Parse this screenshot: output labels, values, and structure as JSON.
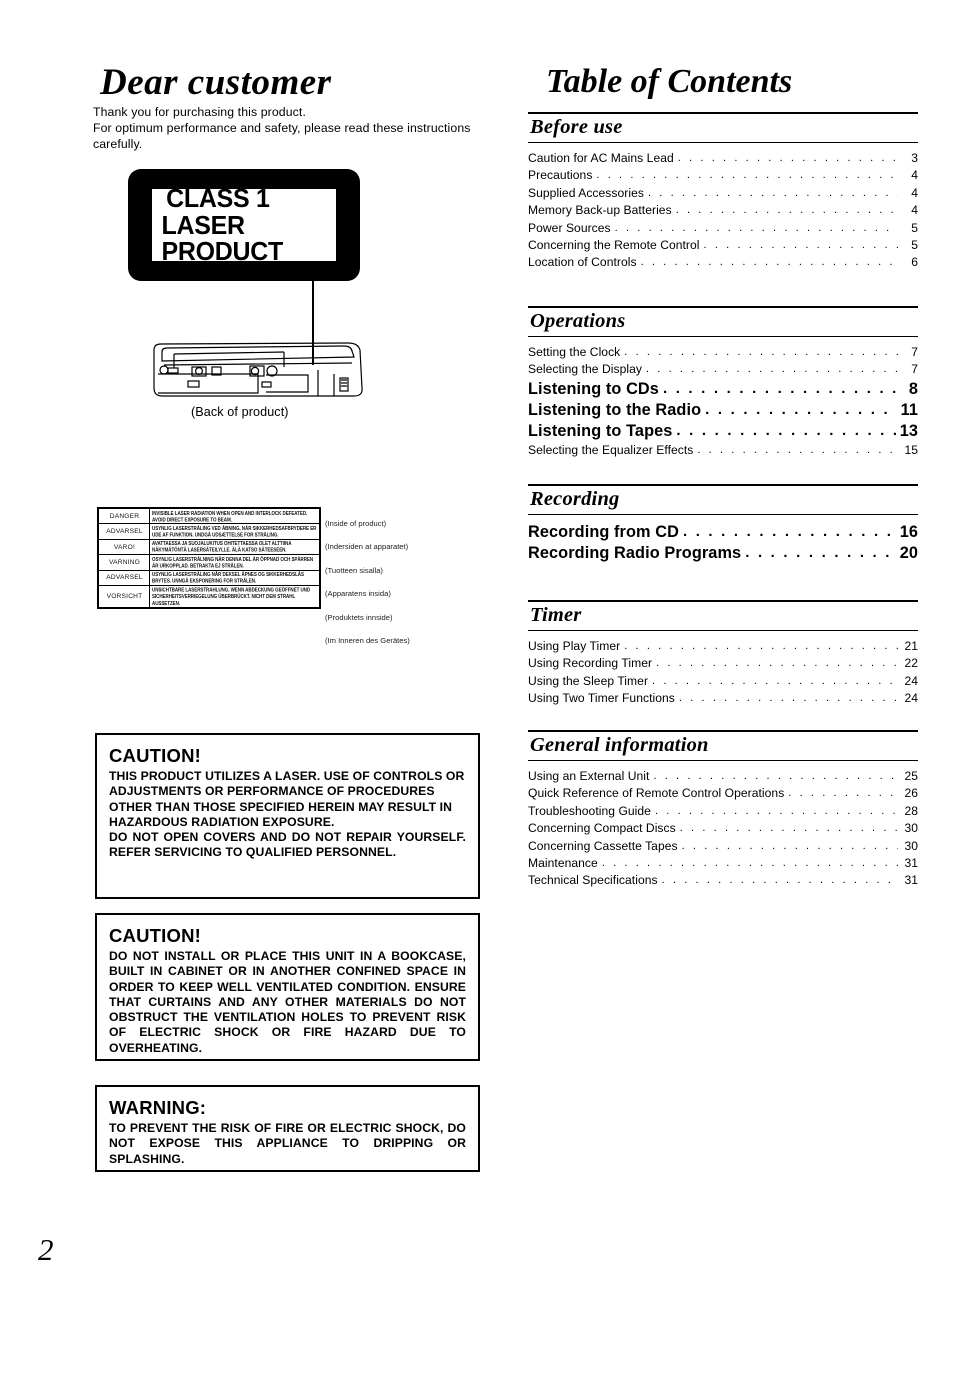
{
  "document": {
    "page_number": "2",
    "left": {
      "heading": "Dear customer",
      "intro_lines": [
        "Thank you for purchasing this product.",
        "For optimum performance and safety, please read these instructions carefully."
      ],
      "laser_label": {
        "line1": "CLASS 1",
        "line2": "LASER PRODUCT"
      },
      "product_caption": "(Back of product)",
      "warning_table": {
        "rows": [
          {
            "lang": "DANGER",
            "text": "INVISIBLE LASER RADIATION WHEN OPEN AND INTERLOCK DEFEATED. AVOID DIRECT EXPOSURE TO BEAM.",
            "note": "(Inside of product)"
          },
          {
            "lang": "ADVARSEL",
            "text": "USYNLIG LASERSTRÅLING VED ÅBNING, NÅR SIKKERHEDSAFBRYDERE ER UDE AF FUNKTION. UNDGÅ UDSÆTTELSE FOR STRÅLING.",
            "note": "(Indersiden at apparatet)"
          },
          {
            "lang": "VARO!",
            "text": "AVATTAESSA JA SUOJALUKITUS OHITETTAESSA OLET ALTTIINA NÄKYMÄTÖNTÄ LASERSÄTEILYLLE. ÄLÄ KATSO SÄTEESEEN.",
            "note": "(Tuotteen sisalla)"
          },
          {
            "lang": "VARNING",
            "text": "OSYNLIG LASERSTRÅLNING NÄR DENNA DEL ÄR ÖPPNAD OCH SPÄRREN ÄR URKOPPLAD. BETRAKTA EJ STRÅLEN.",
            "note": "(Apparatens insida)"
          },
          {
            "lang": "ADVARSEL",
            "text": "USYNLIG LASERSTRÅLING NÅR DEKSEL ÅPNES OG SIKKERHEDSLÅS BRYTES. UNNGÅ EKSPONERING FOR STRÅLEN.",
            "note": "(Produktets innside)"
          },
          {
            "lang": "VORSICHT",
            "text": "UNSICHTBARE LASERSTRAHLUNG, WENN ABDECKUNG GEÖFFNET UND SICHERHEITSVERRIEGELUNG ÜBERBRÜCKT. NICHT DEM STRAHL AUSSETZEN.",
            "note": "(Im Inneren des Gerätes)"
          }
        ]
      },
      "caution_laser": {
        "title": "CAUTION!",
        "paragraph1": "THIS PRODUCT UTILIZES A LASER. USE OF CONTROLS OR ADJUSTMENTS OR PERFORMANCE OF PROCEDURES OTHER THAN THOSE SPECIFIED HEREIN MAY RESULT IN HAZARDOUS RADIATION EXPOSURE.",
        "paragraph2": "DO NOT OPEN COVERS AND DO NOT REPAIR YOURSELF. REFER SERVICING TO QUALIFIED PERSONNEL."
      },
      "caution_install": {
        "title": "CAUTION!",
        "paragraph1": "DO NOT INSTALL OR PLACE THIS UNIT IN A BOOKCASE, BUILT IN CABINET OR IN ANOTHER CONFINED SPACE IN ORDER TO KEEP WELL VENTILATED CONDITION. ENSURE THAT CURTAINS AND ANY OTHER MATERIALS DO NOT OBSTRUCT THE VENTILATION HOLES TO PREVENT RISK OF ELECTRIC SHOCK OR FIRE HAZARD DUE TO OVERHEATING."
      },
      "warning": {
        "title": "WARNING:",
        "paragraph1": "TO PREVENT THE RISK OF FIRE OR ELECTRIC SHOCK, DO NOT EXPOSE THIS APPLIANCE TO DRIPPING OR SPLASHING."
      }
    },
    "toc": {
      "title": "Table of Contents",
      "sections": [
        {
          "heading": "Before use",
          "entries": [
            {
              "label": "Caution for AC Mains Lead",
              "page": "3",
              "emphasis": false
            },
            {
              "label": "Precautions",
              "page": "4",
              "emphasis": false
            },
            {
              "label": "Supplied Accessories",
              "page": "4",
              "emphasis": false
            },
            {
              "label": "Memory Back-up Batteries",
              "page": "4",
              "emphasis": false
            },
            {
              "label": "Power Sources",
              "page": "5",
              "emphasis": false
            },
            {
              "label": "Concerning the Remote Control",
              "page": "5",
              "emphasis": false
            },
            {
              "label": "Location of Controls",
              "page": "6",
              "emphasis": false
            }
          ]
        },
        {
          "heading": "Operations",
          "entries": [
            {
              "label": "Setting the Clock",
              "page": "7",
              "emphasis": false
            },
            {
              "label": "Selecting the Display",
              "page": "7",
              "emphasis": false
            },
            {
              "label": "Listening to CDs",
              "page": "8",
              "emphasis": true
            },
            {
              "label": "Listening to the Radio",
              "page": "11",
              "emphasis": true
            },
            {
              "label": "Listening to Tapes",
              "page": "13",
              "emphasis": true
            },
            {
              "label": "Selecting the Equalizer Effects",
              "page": "15",
              "emphasis": false
            }
          ]
        },
        {
          "heading": "Recording",
          "entries": [
            {
              "label": "Recording from CD",
              "page": "16",
              "emphasis": true
            },
            {
              "label": "Recording Radio Programs",
              "page": "20",
              "emphasis": true
            }
          ]
        },
        {
          "heading": "Timer",
          "entries": [
            {
              "label": "Using Play Timer",
              "page": "21",
              "emphasis": false
            },
            {
              "label": "Using Recording Timer",
              "page": "22",
              "emphasis": false
            },
            {
              "label": "Using the Sleep Timer",
              "page": "24",
              "emphasis": false
            },
            {
              "label": "Using Two Timer Functions",
              "page": "24",
              "emphasis": false
            }
          ]
        },
        {
          "heading": "General information",
          "entries": [
            {
              "label": "Using an External Unit",
              "page": "25",
              "emphasis": false
            },
            {
              "label": "Quick Reference of Remote Control Operations",
              "page": "26",
              "emphasis": false
            },
            {
              "label": "Troubleshooting Guide",
              "page": "28",
              "emphasis": false
            },
            {
              "label": "Concerning Compact Discs",
              "page": "30",
              "emphasis": false
            },
            {
              "label": "Concerning Cassette Tapes",
              "page": "30",
              "emphasis": false
            },
            {
              "label": "Maintenance",
              "page": "31",
              "emphasis": false
            },
            {
              "label": "Technical Specifications",
              "page": "31",
              "emphasis": false
            }
          ]
        }
      ]
    }
  }
}
